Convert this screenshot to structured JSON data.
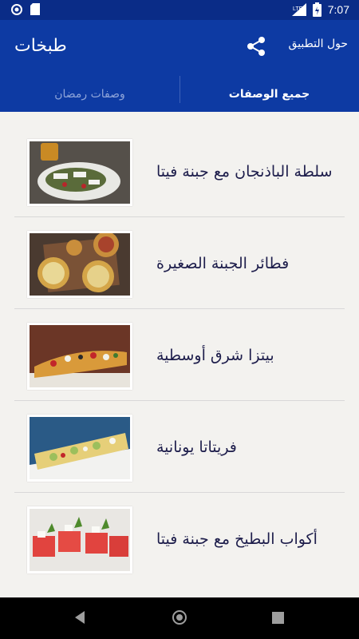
{
  "status": {
    "time": "7:07",
    "network": "LTE"
  },
  "app": {
    "title": "طبخات",
    "about": "حول التطبيق"
  },
  "tabs": [
    {
      "label": "وصفات رمضان",
      "active": false
    },
    {
      "label": "جميع الوصفات",
      "active": true
    }
  ],
  "recipes": [
    {
      "title": "سلطة الباذنجان مع جبنة فيتا"
    },
    {
      "title": "فطائر الجبنة الصغيرة"
    },
    {
      "title": "بيتزا شرق أوسطية"
    },
    {
      "title": "فريتاتا يونانية"
    },
    {
      "title": "أكواب البطيخ مع جبنة فيتا"
    }
  ],
  "colors": {
    "primary": "#0d3aa3",
    "status": "#0a2c87",
    "background": "#f3f2ef",
    "text": "#1d1d4b"
  }
}
